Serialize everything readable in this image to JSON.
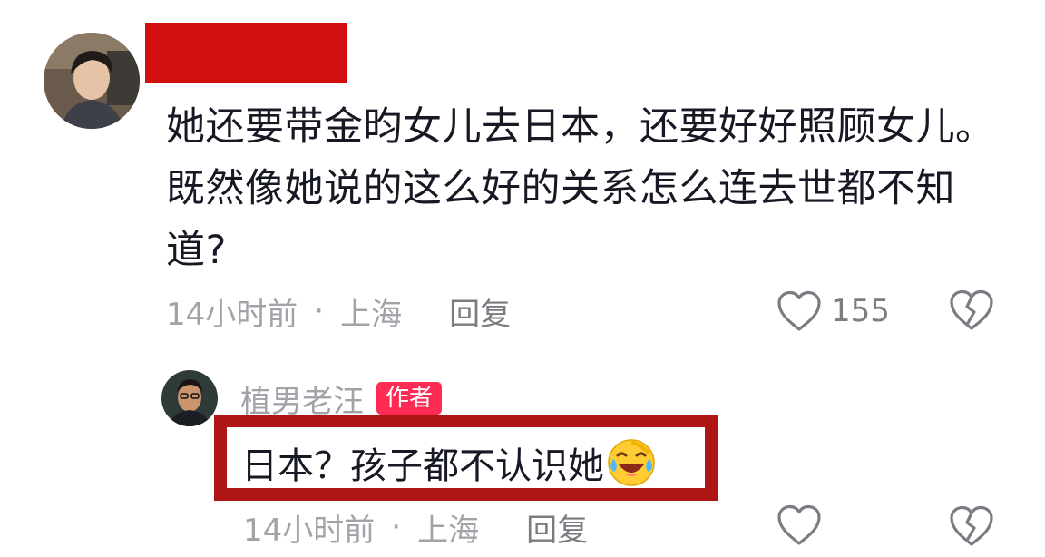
{
  "comment": {
    "text": "她还要带金昀女儿去日本，还要好好照顾女儿。既然像她说的这么好的关系怎么连去世都不知道?",
    "time": "14小时前",
    "separator": "·",
    "location": "上海",
    "reply_label": "回复",
    "like_count": "155",
    "redaction_color": "#d10f0f"
  },
  "reply": {
    "author": "植男老汪",
    "badge": "作者",
    "text": "日本？孩子都不认识她",
    "emoji": "laughing-with-tears-icon",
    "time": "14小时前",
    "separator": "·",
    "location": "上海",
    "reply_label": "回复",
    "highlight_color": "#b01515"
  },
  "icons": {
    "like": "heart-outline-icon",
    "dislike": "broken-heart-icon"
  },
  "colors": {
    "text_primary": "#161823",
    "text_secondary": "#a1a3a8",
    "badge_bg": "#fe2c55"
  }
}
